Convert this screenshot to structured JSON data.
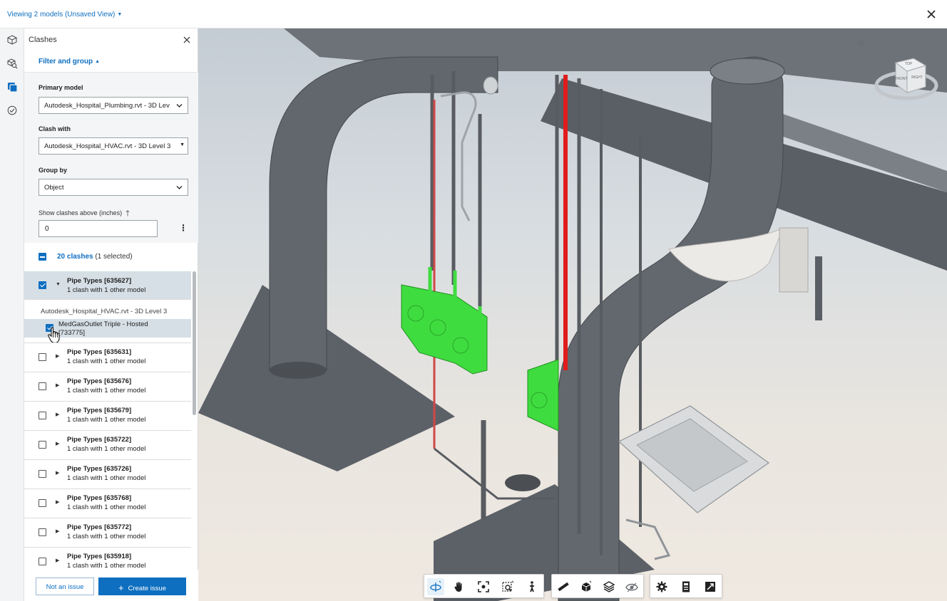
{
  "header": {
    "view_title": "Viewing 2 models (Unsaved View)"
  },
  "rail": {
    "items": [
      "model-browser",
      "clash-search",
      "clashes",
      "issues"
    ]
  },
  "panel": {
    "title": "Clashes",
    "filter_toggle": "Filter and group",
    "primary_model_label": "Primary model",
    "primary_model_value": "Autodesk_Hospital_Plumbing.rvt - 3D Lev",
    "clash_with_label": "Clash with",
    "clash_with_value": "Autodesk_Hospital_HVAC.rvt - 3D Level 3",
    "group_by_label": "Group by",
    "group_by_value": "Object",
    "threshold_label": "Show clashes above (inches)",
    "threshold_value": "0",
    "summary_count": "20 clashes",
    "summary_selected": "(1 selected)"
  },
  "list": {
    "expanded": {
      "title": "Pipe Types [635627]",
      "sub": "1 clash with 1 other model",
      "checked": true,
      "child_model": "Autodesk_Hospital_HVAC.rvt - 3D Level 3",
      "child_item": "MedGasOutlet Triple - Hosted [733775]"
    },
    "rows": [
      {
        "title": "Pipe Types [635631]",
        "sub": "1 clash with 1 other model"
      },
      {
        "title": "Pipe Types [635676]",
        "sub": "1 clash with 1 other model"
      },
      {
        "title": "Pipe Types [635679]",
        "sub": "1 clash with 1 other model"
      },
      {
        "title": "Pipe Types [635722]",
        "sub": "1 clash with 1 other model"
      },
      {
        "title": "Pipe Types [635726]",
        "sub": "1 clash with 1 other model"
      },
      {
        "title": "Pipe Types [635768]",
        "sub": "1 clash with 1 other model"
      },
      {
        "title": "Pipe Types [635772]",
        "sub": "1 clash with 1 other model"
      },
      {
        "title": "Pipe Types [635918]",
        "sub": "1 clash with 1 other model"
      }
    ]
  },
  "footer": {
    "not_issue": "Not an issue",
    "create_issue": "Create issue"
  },
  "viewcube": {
    "top": "TOP",
    "front": "FRONT",
    "right": "RIGHT"
  },
  "colors": {
    "accent": "#0e6fc0",
    "clash_green": "#3fdc3f",
    "clash_red": "#e01c1c",
    "duct_gray": "#5d6167"
  }
}
